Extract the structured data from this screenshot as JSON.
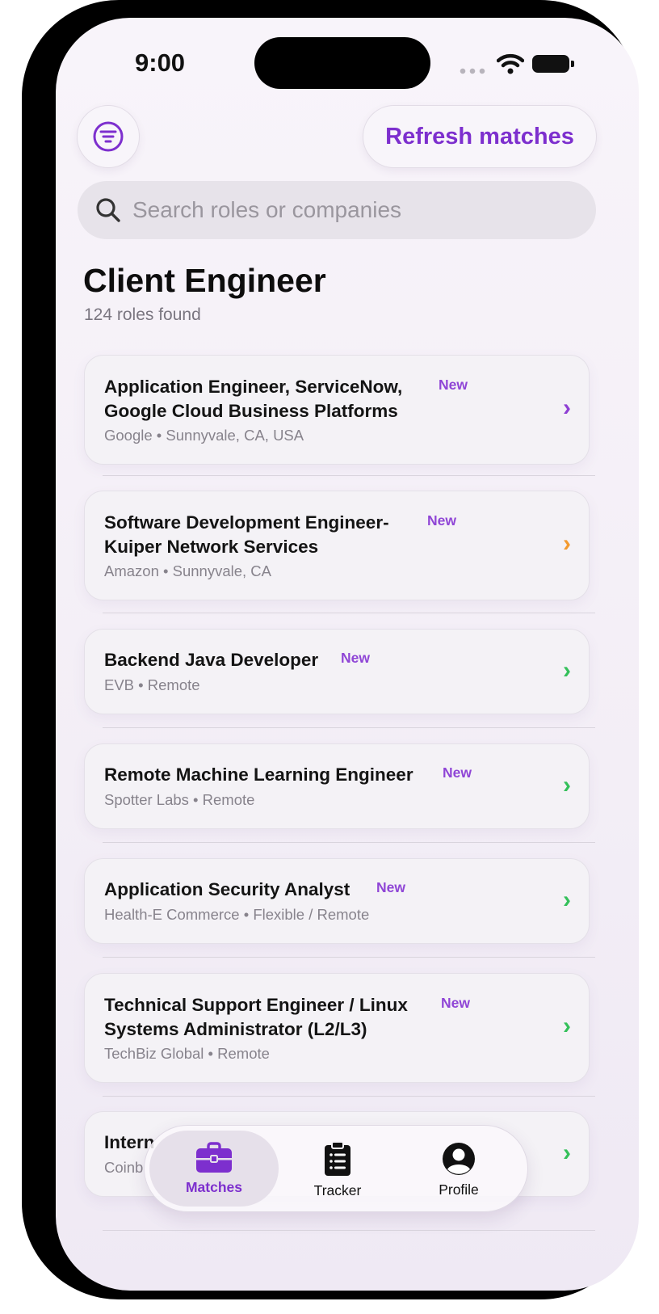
{
  "status_bar": {
    "time": "9:00"
  },
  "header": {
    "refresh_label": "Refresh matches"
  },
  "search": {
    "placeholder": "Search roles or companies",
    "value": ""
  },
  "page": {
    "title": "Client Engineer",
    "subtitle": "124 roles found"
  },
  "jobs": [
    {
      "title": "Application Engineer, ServiceNow, Google Cloud Business Platforms",
      "title_line1": "Application Engineer, ServiceNow,",
      "title_line2": "Google Cloud Business Platforms",
      "badge": "New",
      "company": "Google",
      "location": "Sunnyvale, CA, USA",
      "meta": "Google • Sunnyvale, CA, USA",
      "chevron_color": "#8e3fd3"
    },
    {
      "title": "Software Development Engineer- Kuiper Network Services",
      "title_line1": "Software Development Engineer-",
      "title_line2": "Kuiper Network Services",
      "badge": "New",
      "company": "Amazon",
      "location": "Sunnyvale, CA",
      "meta": "Amazon • Sunnyvale, CA",
      "chevron_color": "#f39a2e"
    },
    {
      "title": "Backend Java Developer",
      "badge": "New",
      "company": "EVB",
      "location": "Remote",
      "meta": "EVB • Remote",
      "chevron_color": "#34c05a"
    },
    {
      "title": "Remote Machine Learning Engineer",
      "badge": "New",
      "company": "Spotter Labs",
      "location": "Remote",
      "meta": "Spotter Labs • Remote",
      "chevron_color": "#34c05a"
    },
    {
      "title": "Application Security Analyst",
      "badge": "New",
      "company": "Health-E Commerce",
      "location": "Flexible / Remote",
      "meta": "Health-E Commerce • Flexible / Remote",
      "chevron_color": "#34c05a"
    },
    {
      "title": "Technical Support Engineer / Linux Systems Administrator (L2/L3)",
      "title_line1": "Technical Support Engineer / Linux",
      "title_line2": "Systems Administrator (L2/L3)",
      "badge": "New",
      "company": "TechBiz Global",
      "location": "Remote",
      "meta": "TechBiz Global • Remote",
      "chevron_color": "#34c05a"
    },
    {
      "title": "Intern",
      "company": "Coinb",
      "location": "",
      "meta": "Coinb",
      "chevron_color": "#34c05a"
    }
  ],
  "tabbar": {
    "tabs": [
      {
        "label": "Matches",
        "icon": "briefcase-icon",
        "active": true
      },
      {
        "label": "Tracker",
        "icon": "clipboard-icon",
        "active": false
      },
      {
        "label": "Profile",
        "icon": "person-circle-icon",
        "active": false
      }
    ]
  },
  "colors": {
    "accent": "#7d2fce",
    "badge": "#8f45d6",
    "green": "#34c05a",
    "orange": "#f39a2e"
  }
}
